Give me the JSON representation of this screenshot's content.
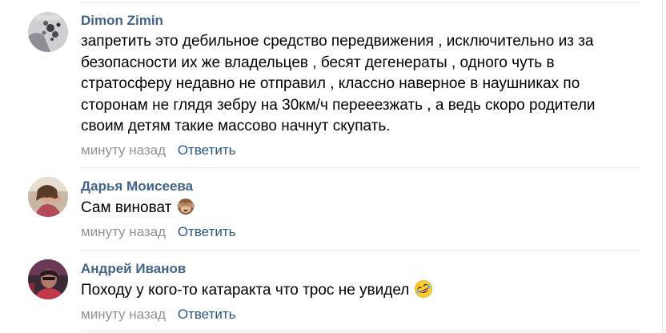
{
  "comments": [
    {
      "author": "Dimon Zimin",
      "text": "запретить это дебильное средство передвижения , исключительно из за безопасности их же владельцев , бесят дегенераты , одного чуть в стратосферу недавно не отправил , классно наверное в наушниках по сторонам не глядя зебру на 30км/ч перееезжать , а ведь скоро родители своим детям такие массово начнут скупать.",
      "time": "минуту назад",
      "reply_label": "Ответить"
    },
    {
      "author": "Дарья Моисеева",
      "text": "Сам виноват",
      "emoji": "see-no-evil-monkey-icon",
      "time": "минуту назад",
      "reply_label": "Ответить"
    },
    {
      "author": "Андрей Иванов",
      "text": "Походу у кого-то катаракта что трос не увидел",
      "emoji": "rolling-laughing-face-icon",
      "time": "минуту назад",
      "reply_label": "Ответить"
    }
  ],
  "colors": {
    "author": "#42648b",
    "reply": "#2a5885",
    "time": "#939393",
    "divider": "#e7e8ec"
  }
}
